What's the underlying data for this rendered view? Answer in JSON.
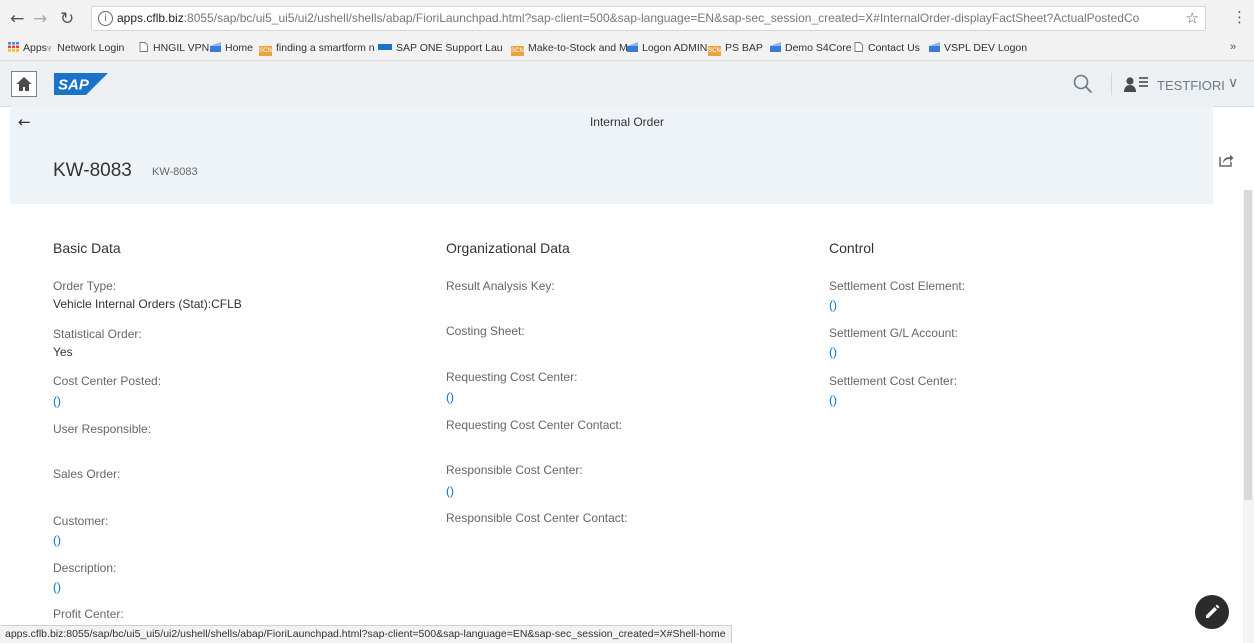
{
  "browser": {
    "url_host": "apps.cflb.biz",
    "url_rest": ":8055/sap/bc/ui5_ui5/ui2/ushell/shells/abap/FioriLaunchpad.html?sap-client=500&sap-language=EN&sap-sec_session_created=X#InternalOrder-displayFactSheet?ActualPostedCo",
    "bookmarks": [
      "Apps",
      "Network Login",
      "HNGIL VPN",
      "Home",
      "finding a smartform n",
      "SAP ONE Support Lau",
      "Make-to-Stock and M",
      "Logon ADMIN",
      "PS BAP",
      "Demo S4Core",
      "Contact Us",
      "VSPL DEV Logon"
    ],
    "more": "»",
    "status_url": "apps.cflb.biz:8055/sap/bc/ui5_ui5/ui2/ushell/shells/abap/FioriLaunchpad.html?sap-client=500&sap-language=EN&sap-sec_session_created=X#Shell-home"
  },
  "shell": {
    "logo": "SAP",
    "user": "TESTFIORI"
  },
  "header": {
    "app_title": "Internal Order",
    "object_title": "KW-8083",
    "object_subtitle": "KW-8083"
  },
  "sections": {
    "basic": {
      "title": "Basic Data",
      "order_type_label": "Order Type:",
      "order_type_value": "Vehicle Internal Orders (Stat):CFLB",
      "statistical_label": "Statistical Order:",
      "statistical_value": "Yes",
      "cc_posted_label": "Cost Center Posted:",
      "cc_posted_value": "()",
      "user_resp_label": "User Responsible:",
      "sales_order_label": "Sales Order:",
      "customer_label": "Customer:",
      "customer_value": "()",
      "description_label": "Description:",
      "description_value": "()",
      "profit_center_label": "Profit Center:"
    },
    "org": {
      "title": "Organizational Data",
      "result_key_label": "Result Analysis Key:",
      "costing_sheet_label": "Costing Sheet:",
      "req_cc_label": "Requesting Cost Center:",
      "req_cc_value": "()",
      "req_cc_contact_label": "Requesting Cost Center Contact:",
      "resp_cc_label": "Responsible Cost Center:",
      "resp_cc_value": "()",
      "resp_cc_contact_label": "Responsible Cost Center Contact:"
    },
    "control": {
      "title": "Control",
      "settle_ce_label": "Settlement Cost Element:",
      "settle_ce_value": "()",
      "settle_gl_label": "Settlement G/L Account:",
      "settle_gl_value": "()",
      "settle_cc_label": "Settlement Cost Center:",
      "settle_cc_value": "()"
    }
  },
  "colors": {
    "link": "#0a6ed1",
    "header_bg": "#eef3f8",
    "shell_bg": "#edf0f3",
    "sap_blue": "#1a73c9"
  }
}
